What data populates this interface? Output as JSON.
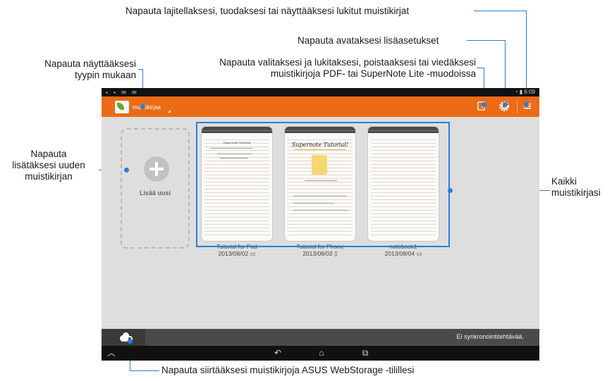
{
  "callouts": {
    "sort_import_locked": "Napauta lajitellaksesi, tuodaksesi tai näyttääksesi lukitut muistikirjat",
    "settings": "Napauta avataksesi lisäasetukset",
    "select_lock_line1": "Napauta valitaksesi ja lukitaksesi, poistaaksesi tai viedäksesi",
    "select_lock_line2": "muistikirjoja PDF- tai SuperNote Lite -muodoissa",
    "by_type_line1": "Napauta näyttääksesi",
    "by_type_line2": "tyypin mukaan",
    "add_new_line1": "Napauta",
    "add_new_line2": "lisätäksesi uuden",
    "add_new_line3": "muistikirjan",
    "all_line1": "Kaikki",
    "all_line2": "muistikirjasi",
    "webstorage": "Napauta siirtääksesi muistikirjoja ASUS WebStorage -tilillesi"
  },
  "status_bar": {
    "time": "6:09"
  },
  "app_bar": {
    "title": "muistikirjaa"
  },
  "add_card": {
    "label": "Lisää uusi"
  },
  "notebooks": [
    {
      "name": "Tutorial for Pad",
      "date": "2013/08/02",
      "cover_title": "Supernote Tutorial"
    },
    {
      "name": "Tutorial for Phone",
      "date": "2013/08/02",
      "cover_title": "Supernote Tutorial!"
    },
    {
      "name": "notebook1",
      "date": "2013/08/04",
      "cover_title": ""
    }
  ],
  "bottom_bar": {
    "sync_status": "Ei synkronointitehtävää."
  },
  "icons": {
    "edit": "edit-icon",
    "settings": "gear-icon",
    "menu": "menu-icon",
    "cloud": "cloud-settings-icon",
    "calendar": "calendar-icon",
    "back": "back-icon",
    "home": "home-icon",
    "recent": "recent-apps-icon",
    "up": "up-icon"
  },
  "colors": {
    "accent": "#ec6b16",
    "callout_line": "#2a7fd4"
  }
}
